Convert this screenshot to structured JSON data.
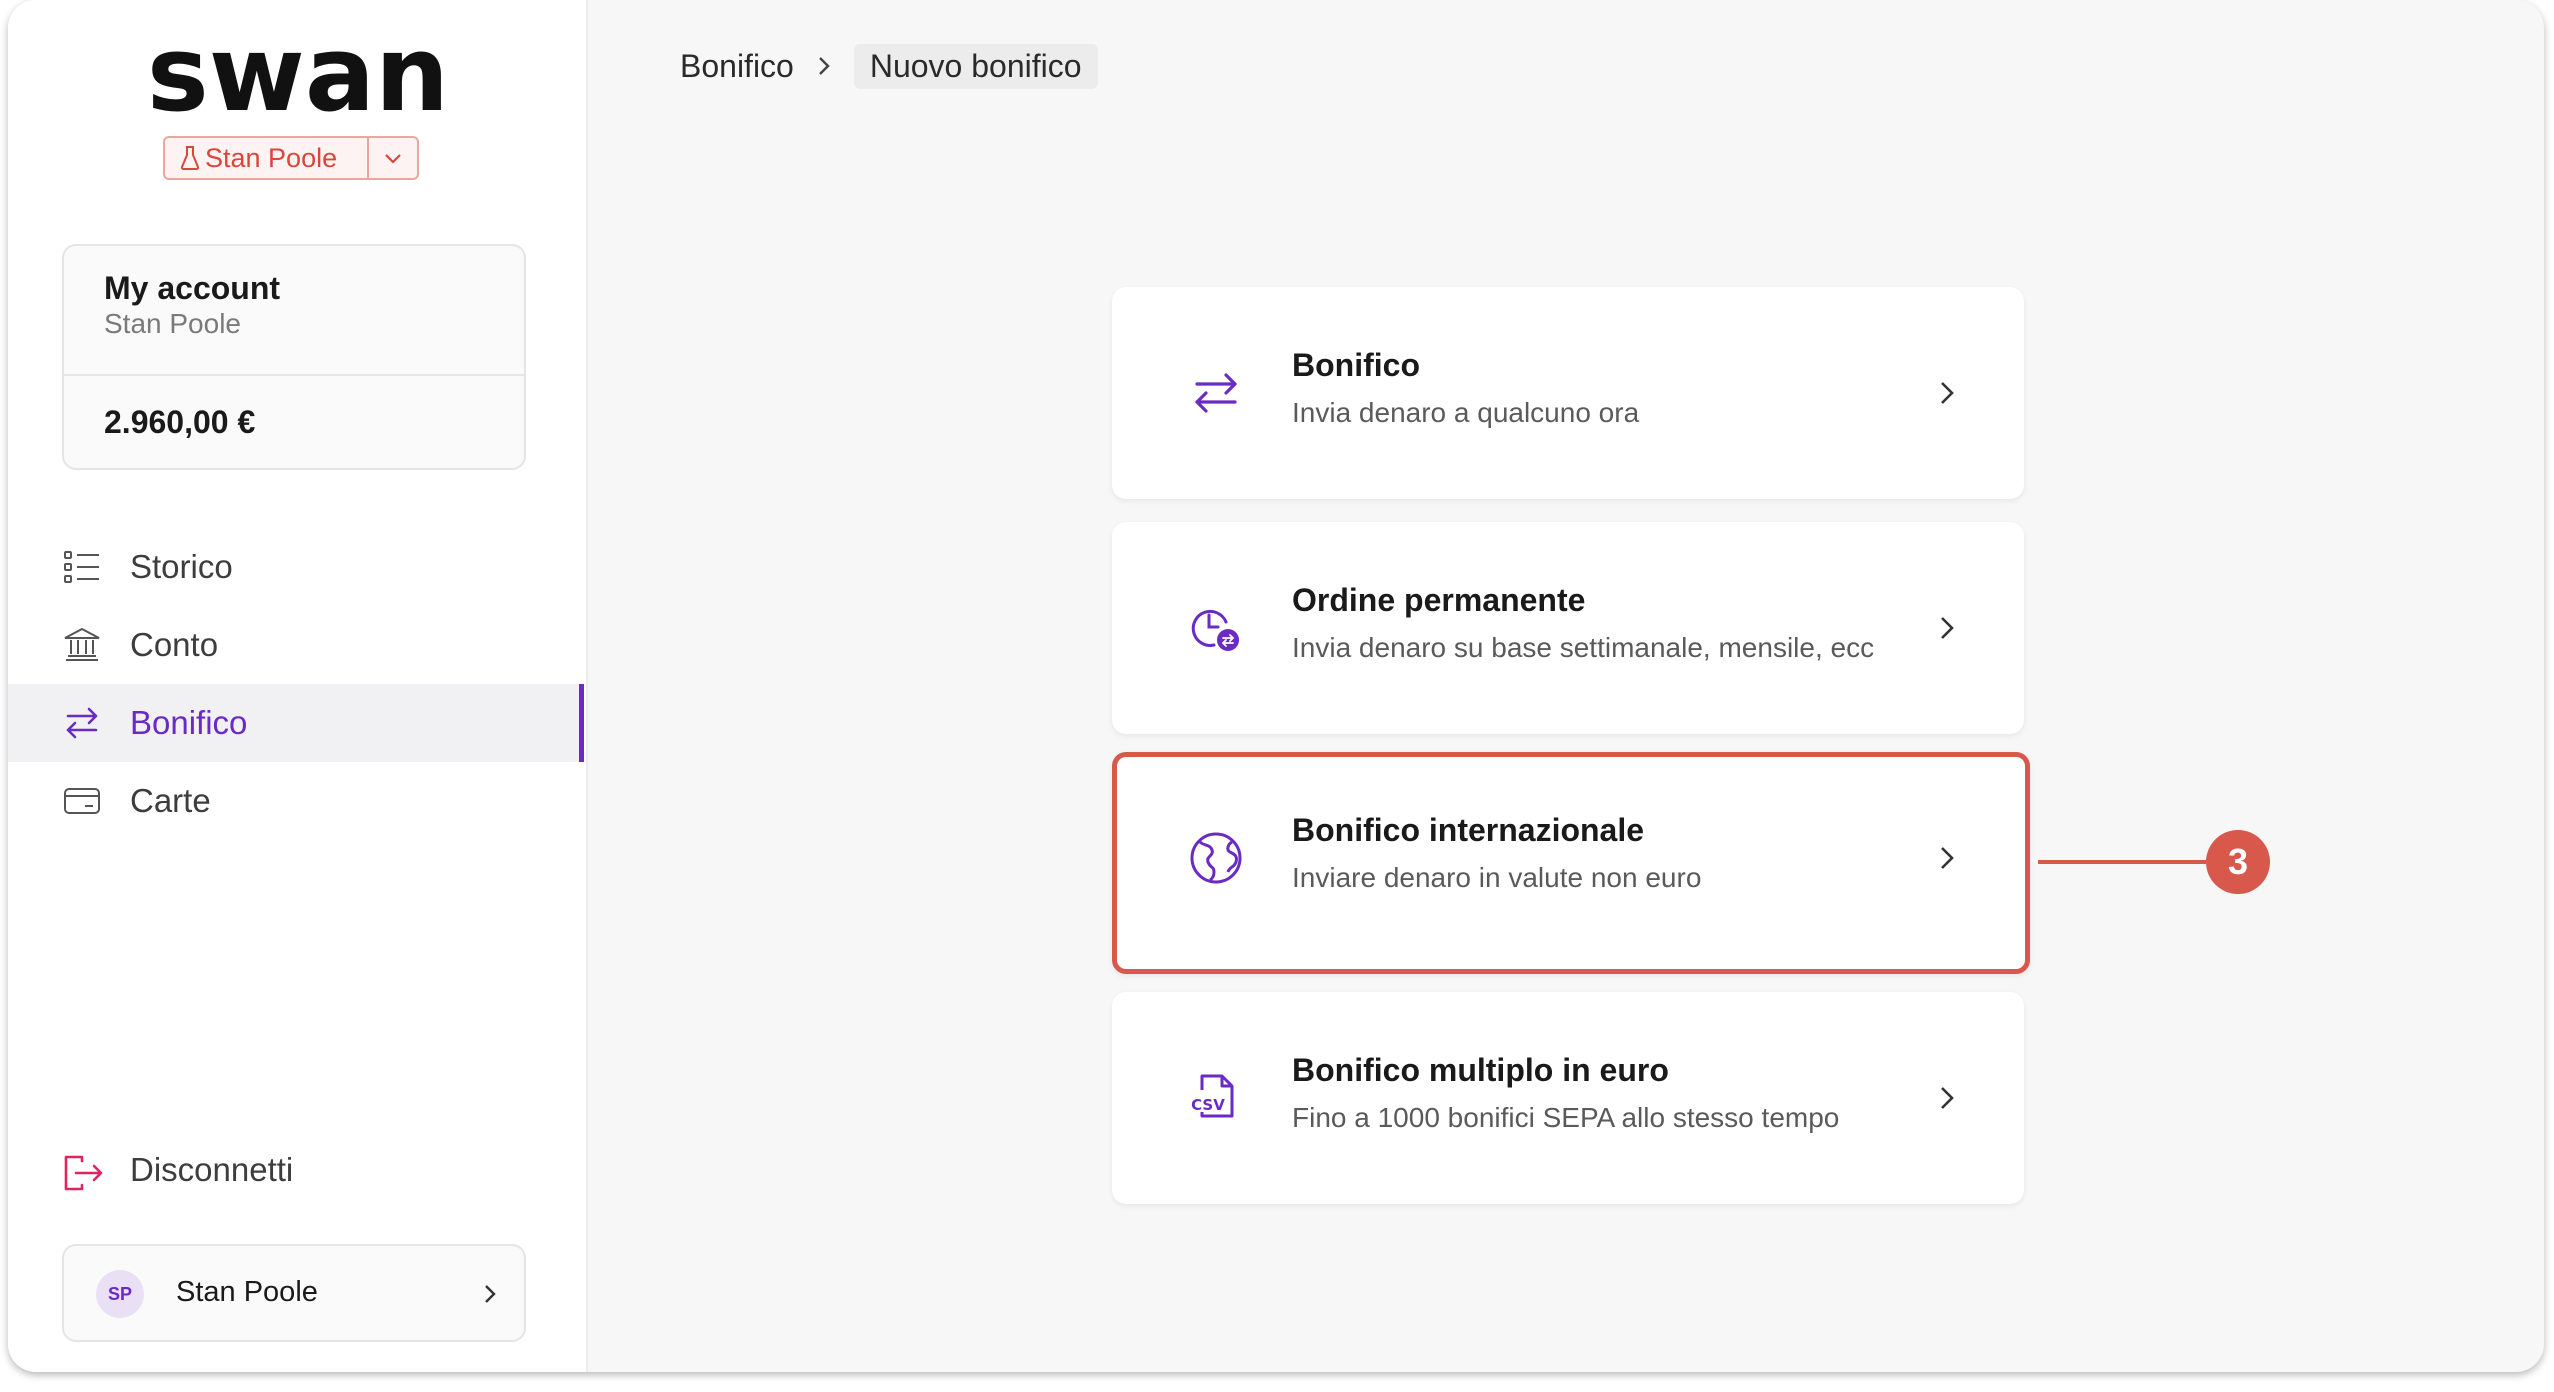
{
  "brand": {
    "logo_text": "swan",
    "accent": "#6a2bc4",
    "highlight": "#d9584c"
  },
  "account_switch": {
    "name": "Stan Poole",
    "flask_icon": "flask-icon",
    "chevron_icon": "chevron-down-icon"
  },
  "account_card": {
    "title": "My account",
    "subtitle": "Stan Poole",
    "balance": "2.960,00 €"
  },
  "nav": {
    "items": [
      {
        "label": "Storico",
        "icon": "list-icon"
      },
      {
        "label": "Conto",
        "icon": "bank-icon"
      },
      {
        "label": "Bonifico",
        "icon": "transfer-icon",
        "active": true
      },
      {
        "label": "Carte",
        "icon": "card-icon"
      }
    ],
    "disconnect": "Disconnetti"
  },
  "user": {
    "initials": "SP",
    "name": "Stan Poole"
  },
  "breadcrumb": {
    "parent": "Bonifico",
    "current": "Nuovo bonifico"
  },
  "options": [
    {
      "title": "Bonifico",
      "description": "Invia denaro a qualcuno ora",
      "icon": "transfer-icon"
    },
    {
      "title": "Ordine permanente",
      "description": "Invia denaro su base settimanale, mensile, ecc",
      "icon": "recurring-clock-icon"
    },
    {
      "title": "Bonifico internazionale",
      "description": "Inviare denaro in valute non euro",
      "icon": "globe-icon",
      "highlighted": true
    },
    {
      "title": "Bonifico multiplo in euro",
      "description": "Fino a 1000 bonifici SEPA allo stesso tempo",
      "icon": "csv-file-icon"
    }
  ],
  "callout": {
    "number": "3"
  }
}
